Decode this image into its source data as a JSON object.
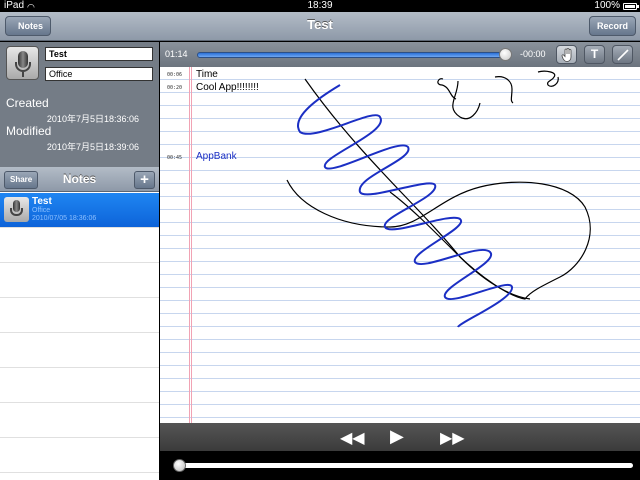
{
  "status": {
    "carrier": "iPad",
    "time": "18:39",
    "battery": "100%"
  },
  "nav": {
    "back_label": "Notes",
    "title": "Test",
    "record_label": "Record"
  },
  "note": {
    "title": "Test",
    "category": "Office",
    "created_label": "Created",
    "created_value": "2010年7月5日18:36:06",
    "modified_label": "Modified",
    "modified_value": "2010年7月5日18:39:06"
  },
  "notes_bar": {
    "share_label": "Share",
    "title": "Notes",
    "add_label": "+"
  },
  "list": [
    {
      "title": "Test",
      "category": "Office",
      "date": "2010/07/05 18:36:06",
      "selected": true
    }
  ],
  "player": {
    "elapsed": "01:14",
    "remaining": "-00:00",
    "progress": 0.99
  },
  "tools": {
    "text_tool": "T"
  },
  "entries": [
    {
      "time": "00:06",
      "text": "Time",
      "color": "#000000"
    },
    {
      "time": "00:20",
      "text": "Cool App!!!!!!!!",
      "color": "#000000"
    },
    {
      "time": "00:45",
      "text": "AppBank",
      "color": "#1b2fc4"
    }
  ],
  "colors": {
    "accent": "#1f86f2",
    "ink_blue": "#1b2fc4",
    "ink_black": "#000000"
  }
}
